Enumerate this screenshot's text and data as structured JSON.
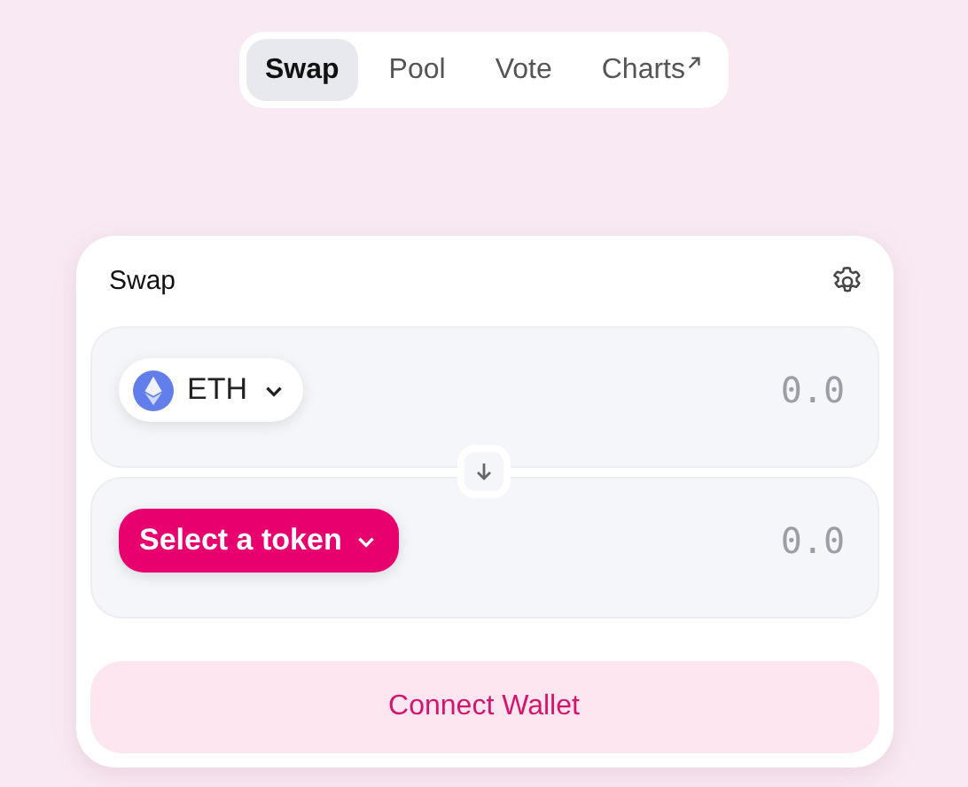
{
  "nav": {
    "tabs": [
      {
        "label": "Swap",
        "selected": true,
        "external": false
      },
      {
        "label": "Pool",
        "selected": false,
        "external": false
      },
      {
        "label": "Vote",
        "selected": false,
        "external": false
      },
      {
        "label": "Charts",
        "selected": false,
        "external": true
      }
    ]
  },
  "swap": {
    "title": "Swap",
    "inputs": [
      {
        "token": {
          "kind": "token",
          "label": "ETH"
        },
        "amount": {
          "placeholder": "0.0"
        }
      },
      {
        "token": {
          "kind": "select",
          "label": "Select a token"
        },
        "amount": {
          "placeholder": "0.0"
        }
      }
    ],
    "connect_button": "Connect Wallet"
  }
}
